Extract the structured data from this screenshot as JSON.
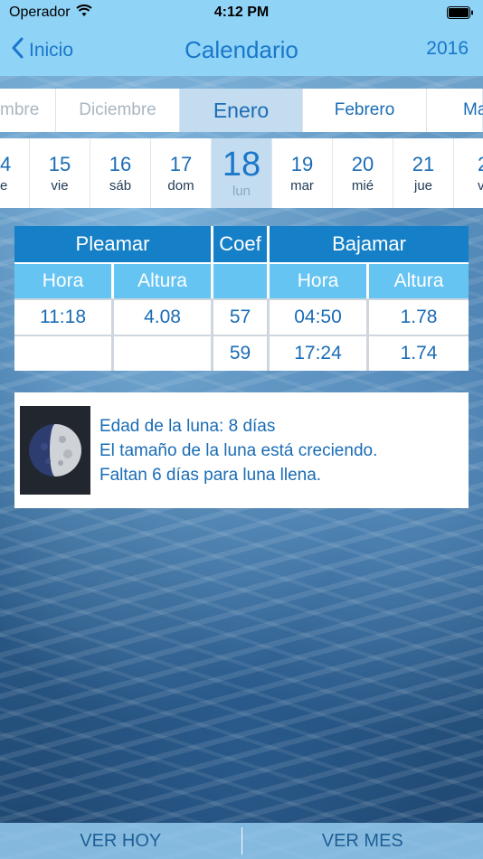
{
  "status_bar": {
    "carrier": "Operador",
    "time": "4:12 PM",
    "wifi_icon": "wifi-icon",
    "battery_icon": "battery-icon"
  },
  "nav": {
    "back_label": "Inicio",
    "title": "Calendario",
    "year": "2016"
  },
  "months": [
    {
      "label": "mbre",
      "state": "faded"
    },
    {
      "label": "Diciembre",
      "state": "faded"
    },
    {
      "label": "Enero",
      "state": "selected"
    },
    {
      "label": "Febrero",
      "state": "normal"
    },
    {
      "label": "Ma",
      "state": "normal"
    }
  ],
  "days": [
    {
      "num": "4",
      "name": "e"
    },
    {
      "num": "15",
      "name": "vie"
    },
    {
      "num": "16",
      "name": "sáb"
    },
    {
      "num": "17",
      "name": "dom"
    },
    {
      "num": "18",
      "name": "lun",
      "selected": true
    },
    {
      "num": "19",
      "name": "mar"
    },
    {
      "num": "20",
      "name": "mié"
    },
    {
      "num": "21",
      "name": "jue"
    },
    {
      "num": "2",
      "name": "vi"
    }
  ],
  "tide_table": {
    "pleamar": "Pleamar",
    "coef": "Coef",
    "bajamar": "Bajamar",
    "hora": "Hora",
    "altura": "Altura",
    "rows": [
      {
        "high_time": "11:18",
        "high_height": "4.08",
        "coef": "57",
        "low_time": "04:50",
        "low_height": "1.78"
      },
      {
        "high_time": "",
        "high_height": "",
        "coef": "59",
        "low_time": "17:24",
        "low_height": "1.74"
      }
    ]
  },
  "moon": {
    "icon": "moon-phase-icon",
    "age": "Edad de la luna: 8 días",
    "trend": "El tamaño de la luna está creciendo.",
    "remaining": "Faltan 6 días para luna llena."
  },
  "toolbar": {
    "today_label": "VER HOY",
    "month_label": "VER MES"
  },
  "colors": {
    "accent": "#1a77c9",
    "header_dark": "#1580c7",
    "header_light": "#66c4f2",
    "nav_bg": "#8fd3f7",
    "selected_bg": "#c4dcef"
  }
}
